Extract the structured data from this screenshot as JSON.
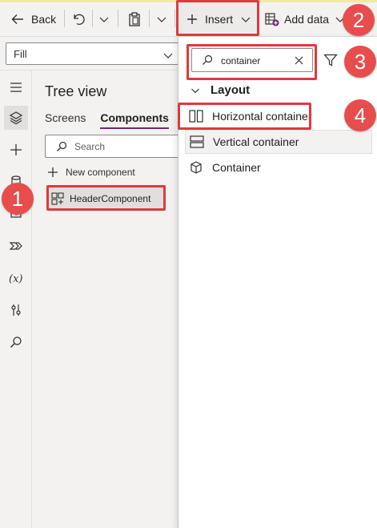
{
  "toolbar": {
    "back_label": "Back",
    "insert_label": "Insert",
    "add_data_label": "Add data"
  },
  "property_bar": {
    "selected_property": "Fill"
  },
  "tree_view": {
    "title": "Tree view",
    "tabs": [
      {
        "label": "Screens",
        "active": false
      },
      {
        "label": "Components",
        "active": true
      }
    ],
    "search_placeholder": "Search",
    "new_component_label": "New component",
    "components": [
      {
        "label": "HeaderComponent",
        "icon": "component-icon",
        "selected": true
      }
    ]
  },
  "insert_panel": {
    "search_value": "container",
    "section": "Layout",
    "items": [
      {
        "label": "Horizontal container",
        "icon": "horizontal-container-icon"
      },
      {
        "label": "Vertical container",
        "icon": "vertical-container-icon"
      },
      {
        "label": "Container",
        "icon": "container-icon"
      }
    ]
  },
  "annotations": {
    "step1": "1",
    "step2": "2",
    "step3": "3",
    "step4": "4",
    "highlight_color": "#e0393e",
    "badge_color": "#e84d4d"
  },
  "colors": {
    "accent_purple": "#742774",
    "background": "#f3f2f1",
    "panel": "#ffffff"
  }
}
